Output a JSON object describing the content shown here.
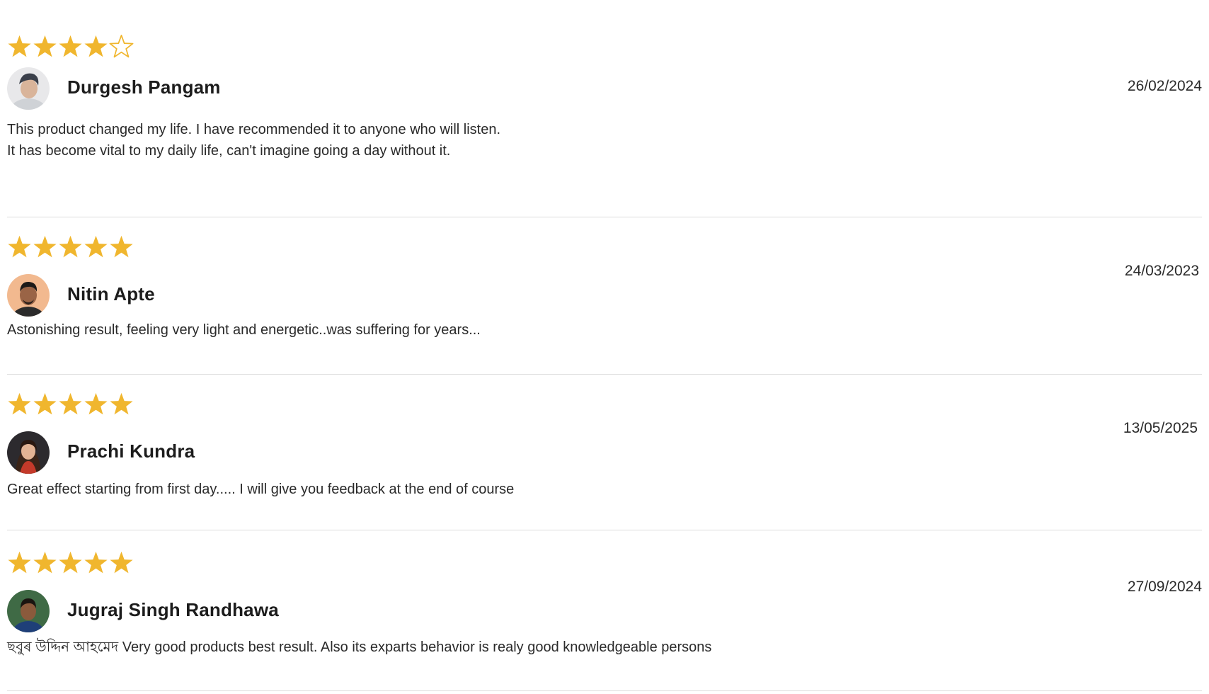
{
  "colors": {
    "star": "#f0b62e",
    "divider": "#dcdcdc",
    "text": "#2a2a2a"
  },
  "reviews": [
    {
      "rating": 4,
      "rating_max": 5,
      "name": "Durgesh Pangam",
      "date": "26/02/2024",
      "lines": [
        "This product changed my life. I have recommended it to anyone who will listen.",
        "It has become vital to my daily life, can't imagine going a day without it."
      ],
      "avatar_icon": "avatar-photo-man-light-background"
    },
    {
      "rating": 5,
      "rating_max": 5,
      "name": "Nitin Apte",
      "date": "24/03/2023",
      "lines": [
        "Astonishing result, feeling very light and energetic..was suffering for years..."
      ],
      "avatar_icon": "avatar-photo-man-peach-background"
    },
    {
      "rating": 5,
      "rating_max": 5,
      "name": "Prachi Kundra",
      "date": "13/05/2025",
      "lines": [
        "Great effect starting from first day..... I will give you feedback at the end of course"
      ],
      "avatar_icon": "avatar-photo-woman-dark-background"
    },
    {
      "rating": 5,
      "rating_max": 5,
      "name": "Jugraj Singh Randhawa",
      "date": "27/09/2024",
      "lines": [
        "ছবুৰ উদ্দিন আহমেদ Very good products best result. Also its exparts behavior is realy good knowledgeable persons"
      ],
      "avatar_icon": "avatar-photo-man-green-background"
    }
  ]
}
